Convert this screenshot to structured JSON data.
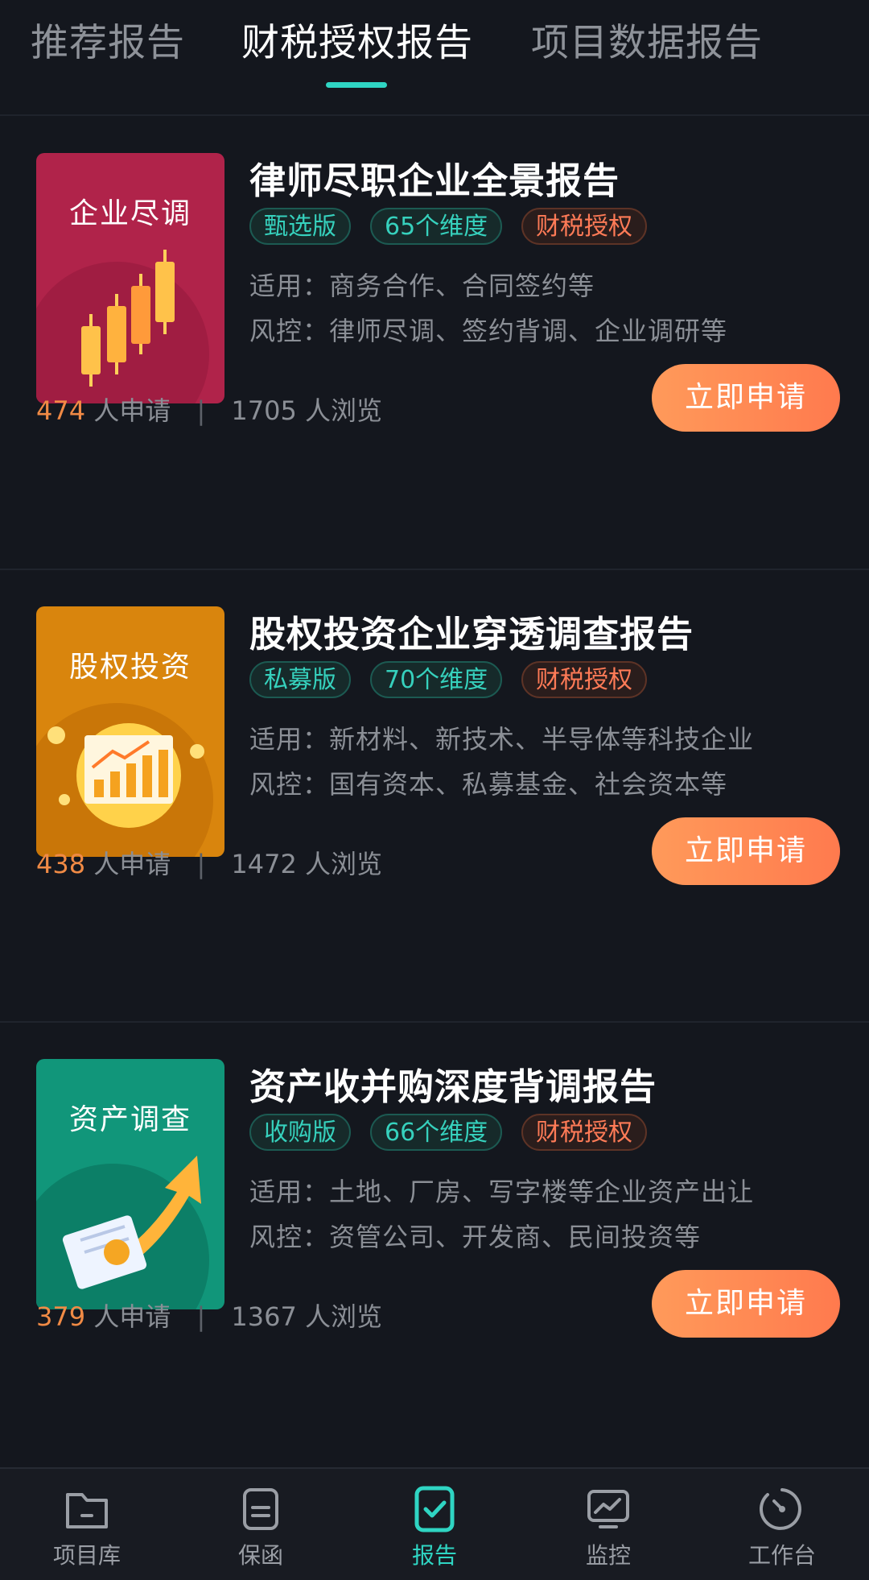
{
  "tabs": [
    {
      "label": "推荐报告",
      "active": false
    },
    {
      "label": "财税授权报告",
      "active": true
    },
    {
      "label": "项目数据报告",
      "active": false
    }
  ],
  "cards": [
    {
      "thumb_label": "企业尽调",
      "thumb_color": "#b0234a",
      "title": "律师尽职企业全景报告",
      "tags": [
        "甄选版",
        "65个维度",
        "财税授权"
      ],
      "usage": "适用：商务合作、合同签约等",
      "risk": "风控：律师尽调、签约背调、企业调研等",
      "applicants": "474",
      "applicants_suffix": "人申请",
      "separator": "|",
      "views": "1705",
      "views_suffix": "人浏览",
      "button": "立即申请"
    },
    {
      "thumb_label": "股权投资",
      "thumb_color": "#d9850d",
      "title": "股权投资企业穿透调查报告",
      "tags": [
        "私募版",
        "70个维度",
        "财税授权"
      ],
      "usage": "适用：新材料、新技术、半导体等科技企业",
      "risk": "风控：国有资本、私募基金、社会资本等",
      "applicants": "438",
      "applicants_suffix": "人申请",
      "separator": "|",
      "views": "1472",
      "views_suffix": "人浏览",
      "button": "立即申请"
    },
    {
      "thumb_label": "资产调查",
      "thumb_color": "#11967a",
      "title": "资产收并购深度背调报告",
      "tags": [
        "收购版",
        "66个维度",
        "财税授权"
      ],
      "usage": "适用：土地、厂房、写字楼等企业资产出让",
      "risk": "风控：资管公司、开发商、民间投资等",
      "applicants": "379",
      "applicants_suffix": "人申请",
      "separator": "|",
      "views": "1367",
      "views_suffix": "人浏览",
      "button": "立即申请"
    }
  ],
  "bottom_nav": [
    {
      "label": "项目库",
      "icon": "folder-icon",
      "active": false
    },
    {
      "label": "保函",
      "icon": "document-icon",
      "active": false
    },
    {
      "label": "报告",
      "icon": "report-check-icon",
      "active": true
    },
    {
      "label": "监控",
      "icon": "monitor-chart-icon",
      "active": false
    },
    {
      "label": "工作台",
      "icon": "dashboard-gauge-icon",
      "active": false
    }
  ],
  "colors": {
    "background": "#14171e",
    "accent_teal": "#2fd5c3",
    "accent_orange": "#ff7b57",
    "number_orange": "#f08a45"
  }
}
